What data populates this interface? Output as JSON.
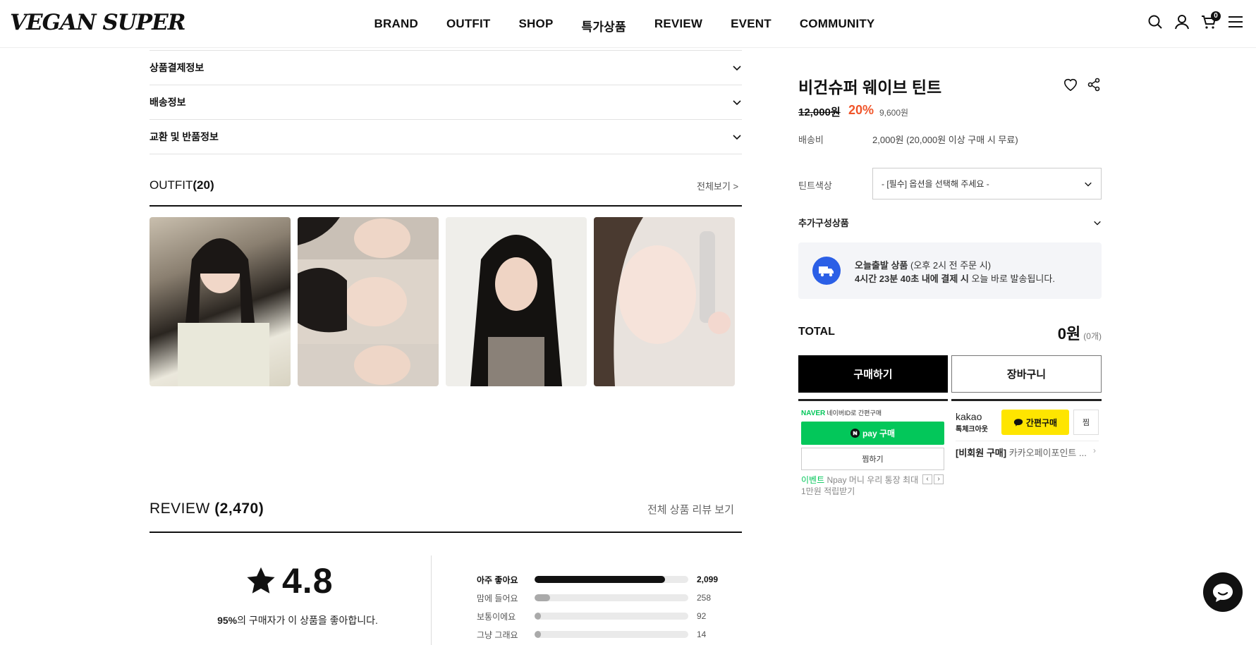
{
  "header": {
    "logo": "VEGAN SUPER",
    "nav": [
      "BRAND",
      "OUTFIT",
      "SHOP",
      "특가상품",
      "REVIEW",
      "EVENT",
      "COMMUNITY"
    ],
    "cart_count": "0",
    "icons": [
      "search-icon",
      "user-icon",
      "cart-icon",
      "menu-icon"
    ]
  },
  "accordion": [
    "상품결제정보",
    "배송정보",
    "교환 및 반품정보"
  ],
  "outfit": {
    "title": "OUTFIT",
    "count": "(20)",
    "view_all": "전체보기 >"
  },
  "review": {
    "title": "REVIEW",
    "count": "(2,470)",
    "view_all": "전체 상품 리뷰 보기",
    "rating": "4.8",
    "like_percent": "95%",
    "like_text": "의 구매자가 이 상품을 좋아합니다.",
    "bars": [
      {
        "label": "아주 좋아요",
        "count": "2,099",
        "fraction": 0.85
      },
      {
        "label": "맘에 들어요",
        "count": "258",
        "fraction": 0.1
      },
      {
        "label": "보통이에요",
        "count": "92",
        "fraction": 0.04
      },
      {
        "label": "그냥 그래요",
        "count": "14",
        "fraction": 0.01
      }
    ]
  },
  "product": {
    "title": "비건슈퍼 웨이브 틴트",
    "price_original": "12,000원",
    "discount_rate": "20%",
    "price_sale": "9,600원",
    "shipping_label": "배송비",
    "shipping_value": "2,000원 (20,000원 이상 구매 시 무료)",
    "option_label": "틴트색상",
    "option_placeholder": "- [필수] 옵션을 선택해 주세요 -",
    "addon_label": "추가구성상품",
    "today_ship_bold": "오늘출발 상품",
    "today_ship_rest": " (오후 2시 전 주문 시)",
    "countdown_bold": "4시간 23분 40초 내에 결제 시",
    "countdown_rest": " 오늘 바로 발송됩니다.",
    "total_label": "TOTAL",
    "total_amount": "0원",
    "total_qty": "(0개)",
    "buy_label": "구매하기",
    "cart_label": "장바구니"
  },
  "naver_pay": {
    "brand": "NAVER",
    "brand_sub": "네이버ID로 간편구매",
    "pay_label": "pay 구매",
    "wish_label": "찜하기",
    "event_tag": "이벤트",
    "event_text": " Npay 머니 우리 통장 최대 1만원 적립받기"
  },
  "kakao": {
    "name": "kakao",
    "sub": "톡체크아웃",
    "buy_label": "간편구매",
    "wish_label": "찜",
    "info_bold": "[비회원 구매]",
    "info_text": " 카카오페이포인트 ..."
  },
  "colors": {
    "discount": "#f0552a",
    "naver": "#03c75a",
    "kakao": "#fee500",
    "ship_icon": "#2b5fe6"
  }
}
